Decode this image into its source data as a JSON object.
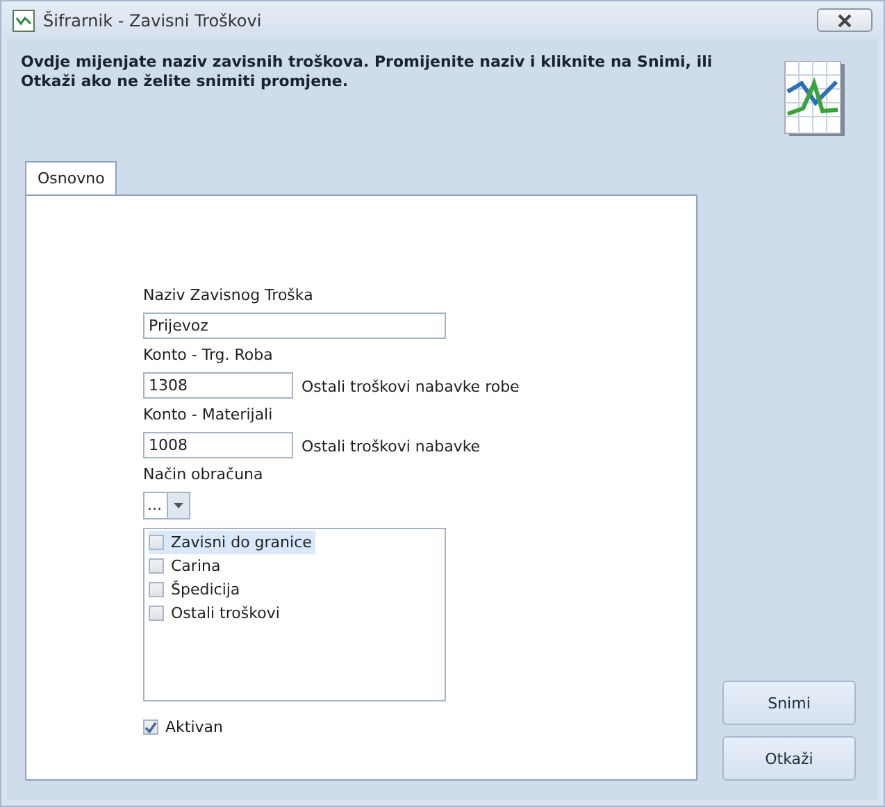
{
  "window": {
    "title": "Šifrarnik - Zavisni Troškovi"
  },
  "header": {
    "message": "Ovdje mijenjate naziv zavisnih troškova. Promijenite naziv i kliknite na Snimi, ili Otkaži ako ne želite snimiti promjene."
  },
  "tabs": [
    {
      "label": "Osnovno",
      "selected": true
    }
  ],
  "form": {
    "naziv": {
      "label": "Naziv Zavisnog Troška",
      "value": "Prijevoz"
    },
    "konto_roba": {
      "label": "Konto - Trg. Roba",
      "value": "1308",
      "description": "Ostali troškovi nabavke robe"
    },
    "konto_materijali": {
      "label": "Konto - Materijali",
      "value": "1008",
      "description": "Ostali troškovi nabavke"
    },
    "nacin": {
      "label": "Način obračuna",
      "value": "..."
    },
    "items": [
      {
        "label": "Zavisni do granice",
        "checked": false,
        "selected": true
      },
      {
        "label": "Carina",
        "checked": false,
        "selected": false
      },
      {
        "label": "Špedicija",
        "checked": false,
        "selected": false
      },
      {
        "label": "Ostali troškovi",
        "checked": false,
        "selected": false
      }
    ],
    "aktivan": {
      "label": "Aktivan",
      "checked": true
    }
  },
  "buttons": [
    {
      "label": "Snimi"
    },
    {
      "label": "Otkaži"
    }
  ]
}
